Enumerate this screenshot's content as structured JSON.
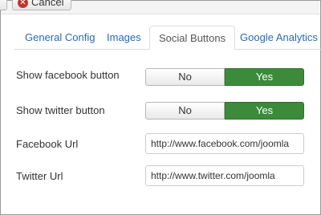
{
  "toolbar": {
    "cancel_label": "Cancel",
    "cancel_icon": "cancel-icon"
  },
  "tabs": [
    {
      "label": "General Config",
      "active": false
    },
    {
      "label": "Images",
      "active": false
    },
    {
      "label": "Social Buttons",
      "active": true
    },
    {
      "label": "Google Analytics",
      "active": false
    }
  ],
  "form": {
    "facebook_button": {
      "label": "Show facebook button",
      "no": "No",
      "yes": "Yes",
      "selected": "Yes"
    },
    "twitter_button": {
      "label": "Show twitter button",
      "no": "No",
      "yes": "Yes",
      "selected": "Yes"
    },
    "facebook_url": {
      "label": "Facebook Url",
      "value": "http://www.facebook.com/joomla"
    },
    "twitter_url": {
      "label": "Twitter Url",
      "value": "http://www.twitter.com/joomla"
    }
  },
  "colors": {
    "accent_green": "#3c8b3a",
    "link_blue": "#2a69b8",
    "cancel_red": "#bd362f"
  }
}
